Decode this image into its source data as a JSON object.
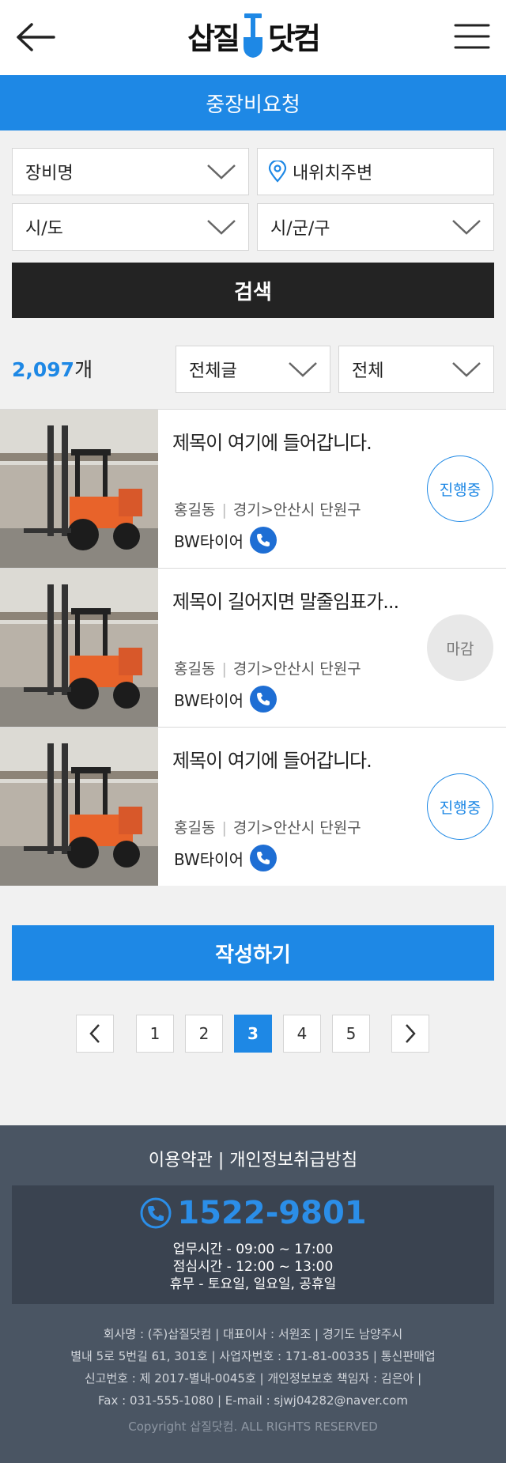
{
  "header": {
    "logo_left": "삽질",
    "logo_right": "닷컴"
  },
  "page_title": "중장비요청",
  "filters": {
    "equipment": "장비명",
    "location": "내위치주변",
    "province": "시/도",
    "city": "시/군/구"
  },
  "search_label": "검색",
  "result": {
    "count": "2,097",
    "unit": "개"
  },
  "sort_selects": [
    "전체글",
    "전체"
  ],
  "listings": [
    {
      "title": "제목이 여기에 들어갑니다.",
      "name": "홍길동",
      "region": "경기>안산시 단원구",
      "company": "BW타이어",
      "status": "진행중",
      "status_type": "on"
    },
    {
      "title": "제목이 길어지면 말줄임표가...",
      "name": "홍길동",
      "region": "경기>안산시 단원구",
      "company": "BW타이어",
      "status": "마감",
      "status_type": "off"
    },
    {
      "title": "제목이 여기에 들어갑니다.",
      "name": "홍길동",
      "region": "경기>안산시 단원구",
      "company": "BW타이어",
      "status": "진행중",
      "status_type": "on"
    }
  ],
  "write_label": "작성하기",
  "pagination": {
    "pages": [
      "1",
      "2",
      "3",
      "4",
      "5"
    ],
    "current": "3"
  },
  "footer": {
    "links": "이용약관 | 개인정보취급방침",
    "phone": "1522-9801",
    "hours": [
      "업무시간 - 09:00 ~ 17:00",
      "점심시간 - 12:00 ~ 13:00",
      "휴무 - 토요일, 일요일, 공휴일"
    ],
    "info": [
      "회사명 : (주)삽질닷컴 | 대표이사 : 서원조 | 경기도 남양주시",
      "별내 5로 5번길 61, 301호  | 사업자번호 : 171-81-00335 | 통신판매업",
      "신고번호 : 제 2017-별내-0045호 | 개인정보보호 책임자 : 김은아 |",
      "Fax : 031-555-1080 | E-mail : sjwj04282@naver.com"
    ],
    "copyright": "Copyright 삽질닷컴. ALL RIGHTS RESERVED"
  },
  "colors": {
    "accent": "#1e88e5",
    "dark": "#232323",
    "footer_bg": "#4a5563",
    "forklift_orange": "#e8632a"
  },
  "icons": [
    "back-arrow-icon",
    "hamburger-menu-icon",
    "shovel-logo-icon",
    "chevron-down-icon",
    "location-pin-icon",
    "phone-icon",
    "chevron-left-icon",
    "chevron-right-icon"
  ]
}
